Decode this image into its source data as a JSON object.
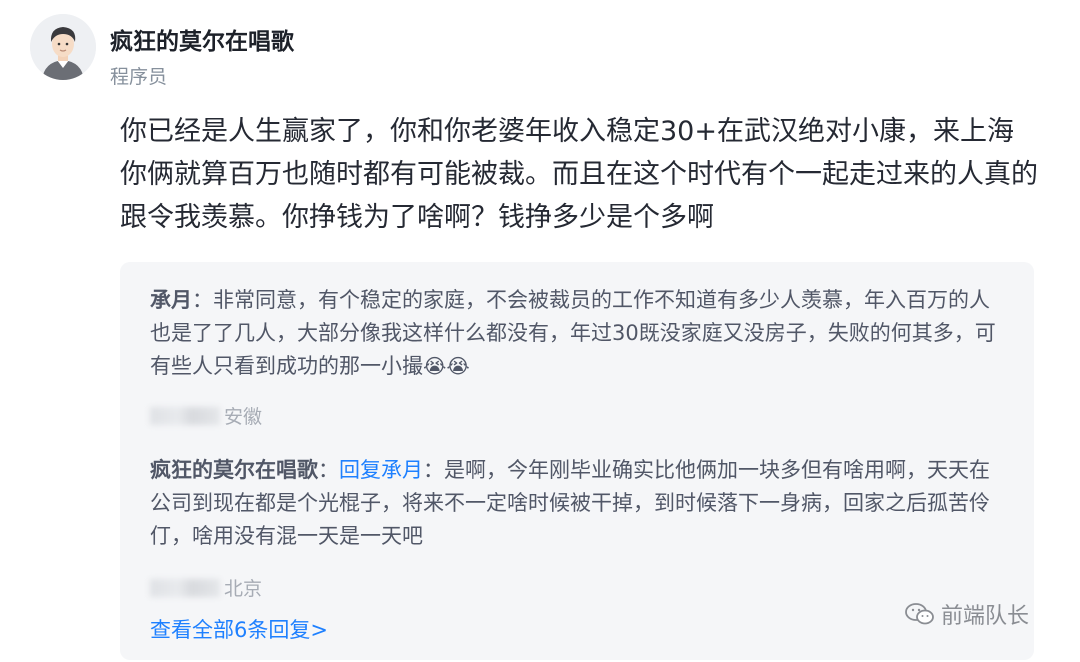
{
  "author": {
    "name": "疯狂的莫尔在唱歌",
    "title": "程序员"
  },
  "comment": {
    "text": "你已经是人生赢家了，你和你老婆年收入稳定30+在武汉绝对小康，来上海你俩就算百万也随时都有可能被裁。而且在这个时代有个一起走过来的人真的跟令我羡慕。你挣钱为了啥啊？钱挣多少是个多啊"
  },
  "replies": [
    {
      "author": "承月",
      "separator": "：",
      "text": "非常同意，有个稳定的家庭，不会被裁员的工作不知道有多少人羡慕，年入百万的人也是了了几人，大部分像我这样什么都没有，年过30既没家庭又没房子，失败的何其多，可有些人只看到成功的那一小撮",
      "emoji": "😭😭",
      "location": "安徽"
    },
    {
      "author": "疯狂的莫尔在唱歌",
      "separator": "：",
      "reply_to": "回复承月",
      "reply_separator": "：",
      "text": "是啊，今年刚毕业确实比他俩加一块多但有啥用啊，天天在公司到现在都是个光棍子，将来不一定啥时候被干掉，到时候落下一身病，回家之后孤苦伶仃，啥用没有混一天是一天吧",
      "location": "北京"
    }
  ],
  "view_all": "查看全部6条回复>",
  "watermark": "前端队长",
  "colors": {
    "link": "#1e80ff",
    "reply_bg": "#f5f6f8"
  }
}
